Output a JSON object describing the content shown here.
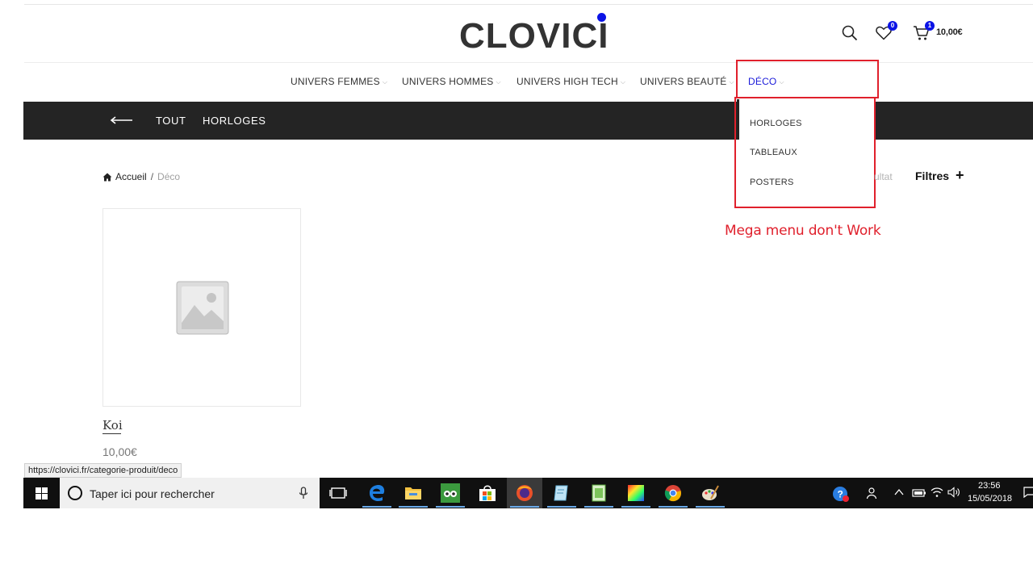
{
  "header": {
    "logo_text": "CLOVICI",
    "wishlist_count": "0",
    "cart_count": "1",
    "cart_total": "10,00€"
  },
  "main_nav": {
    "items": [
      {
        "label": "UNIVERS FEMMES"
      },
      {
        "label": "UNIVERS HOMMES"
      },
      {
        "label": "UNIVERS HIGH TECH"
      },
      {
        "label": "UNIVERS BEAUTÉ"
      },
      {
        "label": "DÉCO",
        "active": true
      }
    ]
  },
  "category_bar": {
    "links": [
      "TOUT",
      "HORLOGES"
    ]
  },
  "dropdown": {
    "items": [
      "HORLOGES",
      "TABLEAUX",
      "POSTERS"
    ]
  },
  "annotation": "Mega menu don't Work",
  "breadcrumb": {
    "home": "Accueil",
    "separator": "/",
    "current": "Déco"
  },
  "results_fragment": "ultat",
  "filters_label": "Filtres",
  "filters_plus": "+",
  "product": {
    "name": "Koi",
    "price": "10,00€"
  },
  "status_url": "https://clovici.fr/categorie-produit/deco",
  "taskbar": {
    "search_placeholder": "Taper ici pour rechercher",
    "time": "23:56",
    "date": "15/05/2018"
  },
  "colors": {
    "accent": "#0b13e6",
    "annotation_red": "#e0202c",
    "category_bar": "#242424"
  }
}
